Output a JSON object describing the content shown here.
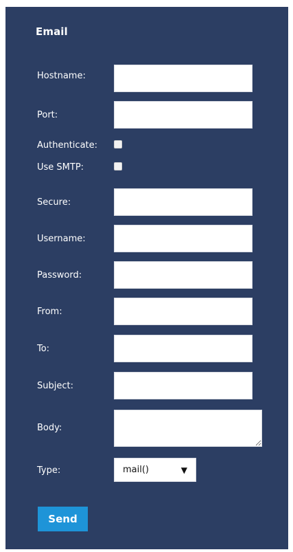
{
  "section": {
    "title": "Email"
  },
  "fields": {
    "hostname": {
      "label": "Hostname:",
      "value": ""
    },
    "port": {
      "label": "Port:",
      "value": ""
    },
    "authenticate": {
      "label": "Authenticate:",
      "checked": false
    },
    "use_smtp": {
      "label": "Use SMTP:",
      "checked": false
    },
    "secure": {
      "label": "Secure:",
      "value": ""
    },
    "username": {
      "label": "Username:",
      "value": ""
    },
    "password": {
      "label": "Password:",
      "value": ""
    },
    "from": {
      "label": "From:",
      "value": ""
    },
    "to": {
      "label": "To:",
      "value": ""
    },
    "subject": {
      "label": "Subject:",
      "value": ""
    },
    "body": {
      "label": "Body:",
      "value": ""
    },
    "type": {
      "label": "Type:",
      "selected": "mail()",
      "arrow_icon": "caret-down-icon"
    }
  },
  "actions": {
    "send_label": "Send"
  },
  "colors": {
    "panel_background": "#2c3e63",
    "accent": "#1e94d8",
    "text": "#ffffff"
  }
}
